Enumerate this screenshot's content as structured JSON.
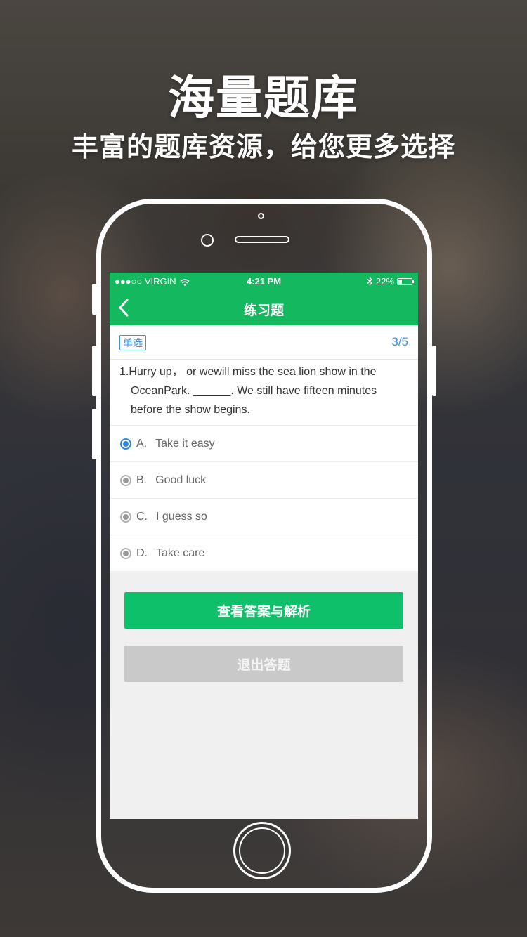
{
  "promo": {
    "title": "海量题库",
    "subtitle": "丰富的题库资源，给您更多选择"
  },
  "status_bar": {
    "carrier": "●●●○○ VIRGIN",
    "time": "4:21 PM",
    "battery": "22%"
  },
  "nav": {
    "back_icon": "‹",
    "title": "练习题"
  },
  "question": {
    "type_tag": "单选",
    "progress": "3/5",
    "lines": [
      "1.Hurry up， or wewill miss the sea lion show in the",
      "OceanPark. ______.  We still have fifteen minutes",
      "before the show begins."
    ],
    "options": [
      {
        "letter": "A.",
        "text": "Take it easy",
        "selected": true
      },
      {
        "letter": "B.",
        "text": "Good luck",
        "selected": false
      },
      {
        "letter": "C.",
        "text": "I guess so",
        "selected": false
      },
      {
        "letter": "D.",
        "text": "Take care",
        "selected": false
      }
    ]
  },
  "actions": {
    "view_answer": "查看答案与解析",
    "exit": "退出答题"
  },
  "colors": {
    "brand_green": "#14b85f",
    "button_green": "#0ec06a",
    "accent_blue": "#3d8ee8",
    "disabled_gray": "#c9c9c9"
  }
}
